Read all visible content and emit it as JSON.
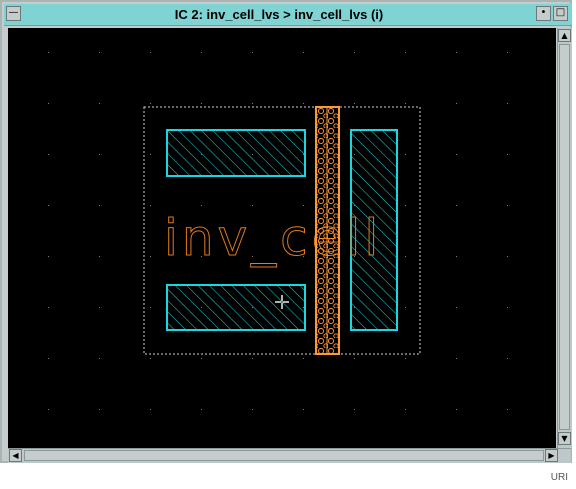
{
  "window": {
    "title": "IC 2: inv_cell_lvs > inv_cell_lvs (i)",
    "menu_glyph": "—",
    "minimize_glyph": "•",
    "maximize_glyph": "□"
  },
  "canvas": {
    "cell_label": "inv_cell",
    "colors": {
      "background": "#000000",
      "grid_dot": "#7a7a7a",
      "boundary": "#d0d0d0",
      "metal": "#1ad6e0",
      "poly": "#ff9933",
      "label": "#e07a1a"
    }
  },
  "scrollbars": {
    "left_arrow": "◀",
    "right_arrow": "▶",
    "up_arrow": "▲",
    "down_arrow": "▼"
  },
  "footer": {
    "label": "URI"
  }
}
